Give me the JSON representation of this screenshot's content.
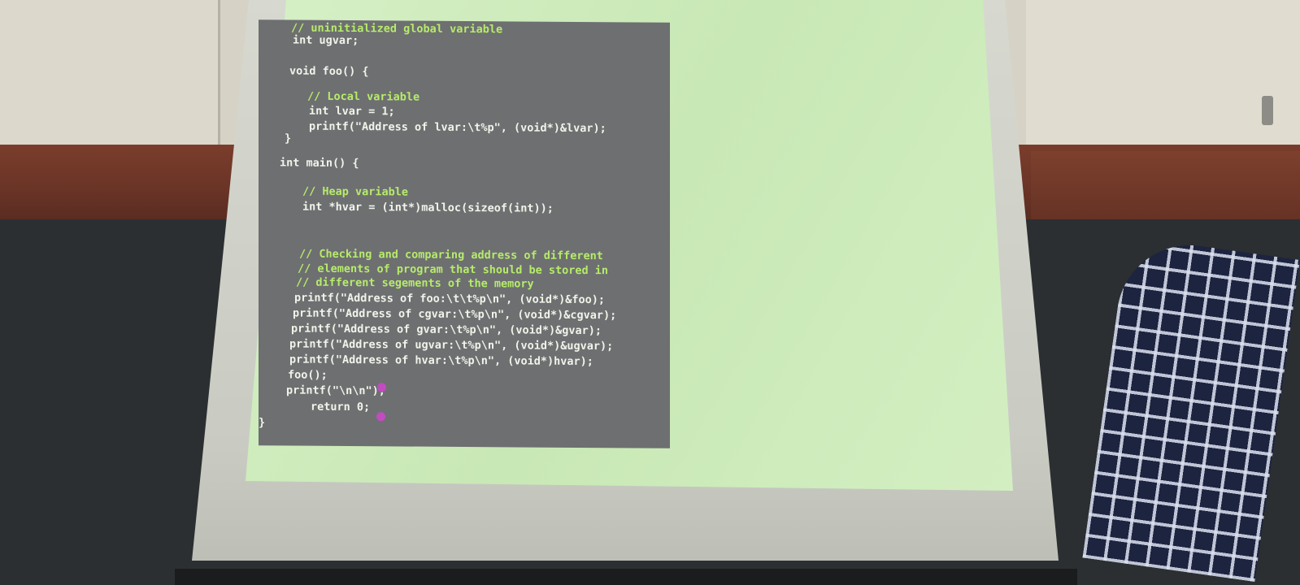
{
  "code_lines": [
    "// uninitialized global variable",
    "int ugvar;",
    "",
    "void foo() {",
    "",
    "    // Local variable",
    "    int lvar = 1;",
    "    printf(\"Address of lvar:\\t%p\", (void*)&lvar);",
    "}",
    "",
    "int main() {",
    "",
    "    // Heap variable",
    "    int *hvar = (int*)malloc(sizeof(int));",
    "",
    "",
    "    // Checking and comparing address of different",
    "    // elements of program that should be stored in",
    "    // different segements of the memory",
    "    printf(\"Address of foo:\\t\\t%p\\n\", (void*)&foo);",
    "    printf(\"Address of cgvar:\\t%p\\n\", (void*)&cgvar);",
    "    printf(\"Address of gvar:\\t%p\\n\", (void*)&gvar);",
    "    printf(\"Address of ugvar:\\t%p\\n\", (void*)&ugvar);",
    "    printf(\"Address of hvar:\\t%p\\n\", (void*)hvar);",
    "    foo();",
    "    printf(\"\\n\\n\");",
    "        return 0;",
    "}"
  ],
  "colors": {
    "comment": "#b6ec6a",
    "string": "#e7929b",
    "editor_bg": "#6e6f71",
    "projection": "#d3efc2",
    "cursor": "#c14cc0"
  }
}
